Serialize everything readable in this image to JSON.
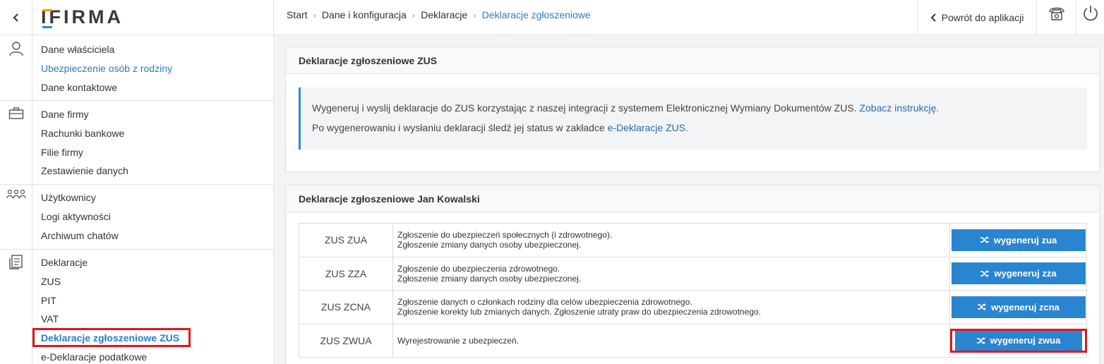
{
  "app": {
    "logo": "IFIRMA",
    "colors": {
      "accent": "#2e7bc4",
      "button": "#2a85d0",
      "highlight": "#e0161f",
      "logo_bar_top": "#f39c12",
      "logo_bar_bottom": "#2e8ad8"
    }
  },
  "rail": {
    "icons": [
      "chevron-left-icon",
      "user-icon",
      "briefcase-icon",
      "users-icon",
      "document-icon"
    ]
  },
  "menu": {
    "groups": [
      {
        "items": [
          "Dane właściciela",
          "Ubezpieczenie osób z rodziny",
          "Dane kontaktowe"
        ]
      },
      {
        "items": [
          "Dane firmy",
          "Rachunki bankowe",
          "Filie firmy",
          "Zestawienie danych"
        ]
      },
      {
        "items": [
          "Użytkownicy",
          "Logi aktywności",
          "Archiwum chatów"
        ]
      },
      {
        "items": [
          "Deklaracje",
          "ZUS",
          "PIT",
          "VAT",
          "Deklaracje zgłoszeniowe ZUS",
          "e-Deklaracje podatkowe"
        ]
      }
    ]
  },
  "breadcrumb": [
    "Start",
    "Dane i konfiguracja",
    "Deklaracje",
    "Deklaracje zgłoszeniowe"
  ],
  "topbar": {
    "back_label": "Powrót do aplikacji",
    "phone_icon": "phone-icon",
    "power_icon": "power-icon"
  },
  "info_panel": {
    "title": "Deklaracje zgłoszeniowe ZUS",
    "line1_text": "Wygeneruj i wyslij deklaracje do ZUS korzystając z naszej integracji z systemem Elektronicznej Wymiany Dokumentów ZUS.",
    "line1_link": "Zobacz instrukcję.",
    "line2_text": "Po wygenerowaniu i wysłaniu deklaracji śledź jej status w zakładce",
    "line2_link": "e-Deklaracje ZUS."
  },
  "decl_panel": {
    "title": "Deklaracje zgłoszeniowe Jan Kowalski",
    "rows": [
      {
        "code": "ZUS ZUA",
        "desc1": "Zgłoszenie do ubezpieczeń społecznych (i zdrowotnego).",
        "desc2": "Zgłoszenie zmiany danych osoby ubezpieczonej.",
        "button": "wygeneruj zua"
      },
      {
        "code": "ZUS ZZA",
        "desc1": "Zgłoszenie do ubezpieczenia zdrowotnego.",
        "desc2": "Zgłoszenie zmiany danych osoby ubezpieczonej.",
        "button": "wygeneruj zza"
      },
      {
        "code": "ZUS ZCNA",
        "desc1": "Zgłoszenie danych o członkach rodziny dla celów ubezpieczenia zdrowotnego.",
        "desc2": "Zgłoszenie korekty lub zmianych danych. Zgłoszenie utraty praw do ubezpieczenia zdrowotnego.",
        "button": "wygeneruj zcna"
      },
      {
        "code": "ZUS ZWUA",
        "desc1": "Wyrejestrowanie z ubezpieczeń.",
        "desc2": "",
        "button": "wygeneruj zwua"
      }
    ]
  }
}
